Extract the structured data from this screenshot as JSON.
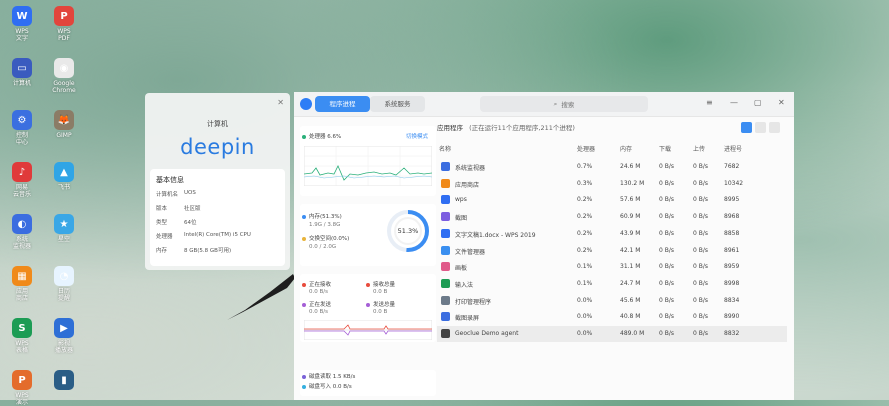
{
  "dock": [
    {
      "label": "WPS\n文字",
      "color": "#2f6ef2",
      "glyph": "W"
    },
    {
      "label": "WPS\nPDF",
      "color": "#e2453c",
      "glyph": "P"
    },
    {
      "label": "计算机",
      "color": "#3a5bbf",
      "glyph": "▭"
    },
    {
      "label": "Google\nChrome",
      "color": "#e9e9e9",
      "glyph": "◉"
    },
    {
      "label": "控制\n中心",
      "color": "#3b6fe0",
      "glyph": "⚙"
    },
    {
      "label": "GIMP",
      "color": "#8b7c66",
      "glyph": "🦊"
    },
    {
      "label": "网易\n云音乐",
      "color": "#e03a3a",
      "glyph": "♪"
    },
    {
      "label": "飞书",
      "color": "#2fa5e6",
      "glyph": "▲"
    },
    {
      "label": "系统\n监视器",
      "color": "#3b6de0",
      "glyph": "◐"
    },
    {
      "label": "星空",
      "color": "#3aa7e6",
      "glyph": "★"
    },
    {
      "label": "应用\n商店",
      "color": "#f08a1a",
      "glyph": "▦"
    },
    {
      "label": "日历\n提醒",
      "color": "#e7f4ff",
      "glyph": "◔"
    },
    {
      "label": "WPS\n表格",
      "color": "#1c9c54",
      "glyph": "S"
    },
    {
      "label": "影视\n播放器",
      "color": "#2e6fd6",
      "glyph": "▶"
    },
    {
      "label": "WPS\n演示",
      "color": "#e46c2c",
      "glyph": "P"
    },
    {
      "label": "",
      "color": "#2a5d86",
      "glyph": "▮"
    }
  ],
  "about": {
    "title": "计算机",
    "logo": "deepin",
    "section": "基本信息",
    "rows": [
      {
        "k": "计算机名",
        "v": "UOS"
      },
      {
        "k": "版本",
        "v": "社区版"
      },
      {
        "k": "类型",
        "v": "64位"
      },
      {
        "k": "处理器",
        "v": "Intel(R) Core(TM) i5 CPU"
      },
      {
        "k": "内存",
        "v": "8 GB(5.8 GB可用)"
      }
    ]
  },
  "window": {
    "tab_active": "程序进程",
    "tab_inactive": "系统服务",
    "search_placeholder": "搜索",
    "cpu": {
      "label": "处理器",
      "value": "6.6%",
      "link": "切换模式"
    },
    "memory": {
      "ring_value": "51.3%",
      "mem_label": "内存(51.3%)",
      "mem_detail": "1.9G / 3.8G",
      "swap_label": "交换空间(0.0%)",
      "swap_detail": "0.0 / 2.0G"
    },
    "network": {
      "recv_label": "正在接收",
      "recv_value": "0.0 B/s",
      "send_label": "正在发送",
      "send_value": "0.0 B/s",
      "total_recv_label": "接收总量",
      "total_recv_value": "0.0 B",
      "total_send_label": "发送总量",
      "total_send_value": "0.0 B"
    },
    "disk": {
      "read_label": "磁盘读取",
      "read_value": "1.5 KB/s",
      "write_label": "磁盘写入",
      "write_value": "0.0 B/s"
    },
    "process_heading": "应用程序",
    "process_summary": "(正在运行11个应用程序,211个进程)",
    "columns": [
      "名称",
      "处理器",
      "内存",
      "下载",
      "上传",
      "进程号"
    ],
    "processes": [
      {
        "name": "系统监视器",
        "cpu": "0.7%",
        "mem": "24.6 M",
        "down": "0 B/s",
        "up": "0 B/s",
        "pid": "7682",
        "color": "#3b6de0"
      },
      {
        "name": "应用商店",
        "cpu": "0.3%",
        "mem": "130.2 M",
        "down": "0 B/s",
        "up": "0 B/s",
        "pid": "10342",
        "color": "#f08a1a"
      },
      {
        "name": "wps",
        "cpu": "0.2%",
        "mem": "57.6 M",
        "down": "0 B/s",
        "up": "0 B/s",
        "pid": "8995",
        "color": "#2f6ef2"
      },
      {
        "name": "截图",
        "cpu": "0.2%",
        "mem": "60.9 M",
        "down": "0 B/s",
        "up": "0 B/s",
        "pid": "8968",
        "color": "#7c5de0"
      },
      {
        "name": "文字文稿1.docx - WPS 2019",
        "cpu": "0.2%",
        "mem": "43.9 M",
        "down": "0 B/s",
        "up": "0 B/s",
        "pid": "8858",
        "color": "#2f6ef2"
      },
      {
        "name": "文件管理器",
        "cpu": "0.2%",
        "mem": "42.1 M",
        "down": "0 B/s",
        "up": "0 B/s",
        "pid": "8961",
        "color": "#3a8ff0"
      },
      {
        "name": "画板",
        "cpu": "0.1%",
        "mem": "31.1 M",
        "down": "0 B/s",
        "up": "0 B/s",
        "pid": "8959",
        "color": "#e05a8a"
      },
      {
        "name": "输入法",
        "cpu": "0.1%",
        "mem": "24.7 M",
        "down": "0 B/s",
        "up": "0 B/s",
        "pid": "8998",
        "color": "#1c9c54"
      },
      {
        "name": "打印管理程序",
        "cpu": "0.0%",
        "mem": "45.6 M",
        "down": "0 B/s",
        "up": "0 B/s",
        "pid": "8834",
        "color": "#6c7a89"
      },
      {
        "name": "截图录屏",
        "cpu": "0.0%",
        "mem": "40.8 M",
        "down": "0 B/s",
        "up": "0 B/s",
        "pid": "8990",
        "color": "#3b6de0"
      },
      {
        "name": "Geoclue Demo agent",
        "cpu": "0.0%",
        "mem": "489.0 M",
        "down": "0 B/s",
        "up": "0 B/s",
        "pid": "8832",
        "color": "#444444"
      }
    ]
  },
  "colors": {
    "accent": "#3b8df2",
    "cpu_line": "#2ab07a",
    "mem_ring": "#3b8df2",
    "net_recv": "#e84c3d",
    "net_send": "#a55fd6",
    "disk_read": "#7b63d8",
    "disk_write": "#36b0e0"
  }
}
